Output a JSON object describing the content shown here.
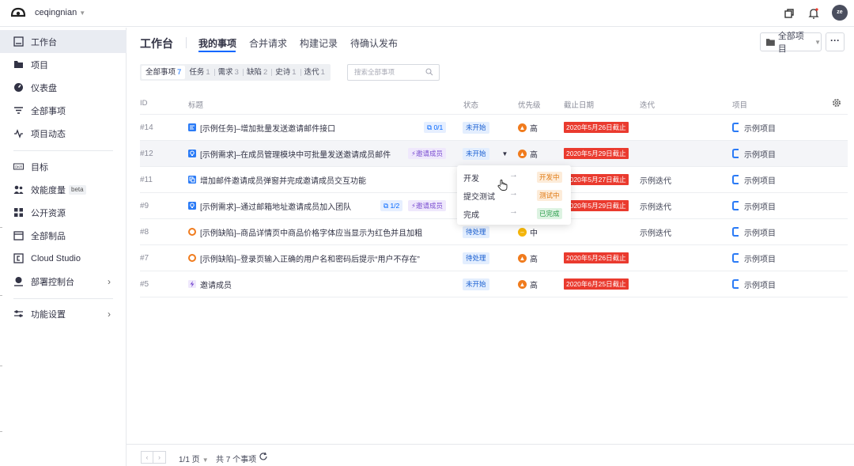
{
  "topbar": {
    "username": "ceqingnian",
    "avatar_text": "ze"
  },
  "sidebar": {
    "items": [
      {
        "label": "工作台",
        "icon": "workbench-icon"
      },
      {
        "label": "项目",
        "icon": "folder-icon"
      },
      {
        "label": "仪表盘",
        "icon": "dashboard-icon"
      },
      {
        "label": "全部事项",
        "icon": "filter-icon"
      },
      {
        "label": "项目动态",
        "icon": "activity-icon"
      },
      {
        "label": "目标",
        "icon": "okr-icon"
      },
      {
        "label": "效能度量",
        "icon": "metrics-icon",
        "badge": "beta"
      },
      {
        "label": "公开资源",
        "icon": "grid-icon"
      },
      {
        "label": "全部制品",
        "icon": "artifact-icon"
      },
      {
        "label": "Cloud Studio",
        "icon": "cloud-studio-icon"
      },
      {
        "label": "部署控制台",
        "icon": "deploy-icon"
      },
      {
        "label": "功能设置",
        "icon": "settings-icon"
      }
    ]
  },
  "header": {
    "title": "工作台",
    "tabs": [
      "我的事项",
      "合并请求",
      "构建记录",
      "待确认发布"
    ],
    "project_select": "全部项目",
    "more": "···"
  },
  "filters": [
    {
      "label": "全部事项",
      "count": "7"
    },
    {
      "label": "任务",
      "count": "1"
    },
    {
      "label": "需求",
      "count": "3"
    },
    {
      "label": "缺陷",
      "count": "2"
    },
    {
      "label": "史诗",
      "count": "1"
    },
    {
      "label": "迭代",
      "count": "1"
    }
  ],
  "search": {
    "placeholder": "搜索全部事项"
  },
  "columns": {
    "id": "ID",
    "title": "标题",
    "status": "状态",
    "priority": "优先级",
    "due": "截止日期",
    "iteration": "迭代",
    "project": "项目"
  },
  "rows": [
    {
      "id": "#14",
      "title": "[示例任务]–增加批量发送邀请邮件接口",
      "type": "task",
      "sub": "0/1",
      "epic": "",
      "status": "未开始",
      "priority": "高",
      "due": "2020年5月26日截止",
      "iteration": "",
      "project": "示例项目"
    },
    {
      "id": "#12",
      "title": "[示例需求]–在成员管理模块中可批量发送邀请成员邮件",
      "type": "story",
      "sub": "",
      "epic": "邀请成员",
      "status": "未开始",
      "priority": "高",
      "due": "2020年5月29日截止",
      "iteration": "",
      "project": "示例项目"
    },
    {
      "id": "#11",
      "title": "增加邮件邀请成员弹窗并完成邀请成员交互功能",
      "type": "subtask",
      "sub": "",
      "epic": "",
      "status": "",
      "priority": "",
      "due": "2020年5月27日截止",
      "iteration": "示例迭代",
      "project": "示例项目"
    },
    {
      "id": "#9",
      "title": "[示例需求]–通过邮箱地址邀请成员加入团队",
      "type": "story",
      "sub": "1/2",
      "epic": "邀请成员",
      "status": "",
      "priority": "",
      "due": "2020年5月29日截止",
      "iteration": "示例迭代",
      "project": "示例项目"
    },
    {
      "id": "#8",
      "title": "[示例缺陷]–商品详情页中商品价格字体应当显示为红色并且加粗",
      "type": "bug",
      "sub": "",
      "epic": "",
      "status": "待处理",
      "priority": "中",
      "due": "",
      "iteration": "示例迭代",
      "project": "示例项目"
    },
    {
      "id": "#7",
      "title": "[示例缺陷]–登录页输入正确的用户名和密码后提示“用户不存在”",
      "type": "bug",
      "sub": "",
      "epic": "",
      "status": "待处理",
      "priority": "高",
      "due": "2020年5月26日截止",
      "iteration": "",
      "project": "示例项目"
    },
    {
      "id": "#5",
      "title": "邀请成员",
      "type": "epic",
      "sub": "",
      "epic": "",
      "status": "未开始",
      "priority": "高",
      "due": "2020年6月25日截止",
      "iteration": "",
      "project": "示例项目"
    }
  ],
  "dropdown": [
    {
      "label": "开发",
      "target": "开发中"
    },
    {
      "label": "提交测试",
      "target": "测试中"
    },
    {
      "label": "完成",
      "target": "已完成"
    }
  ],
  "footer": {
    "page": "1/1 页",
    "total": "共 7 个事项"
  },
  "colors": {
    "accent": "#0066ff",
    "overdue": "#ea3a2e",
    "priority_high": "#f07b1d",
    "priority_mid": "#f5b60a"
  }
}
